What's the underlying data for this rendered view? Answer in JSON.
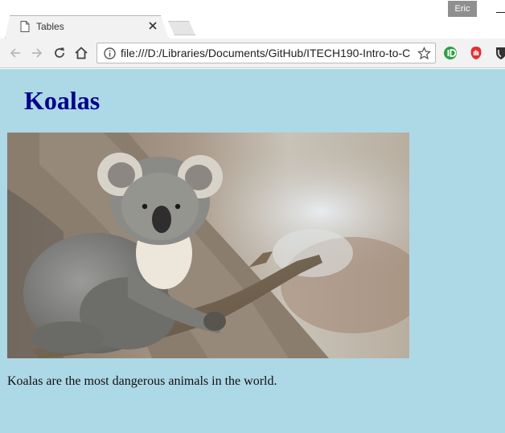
{
  "browser": {
    "profile_name": "Eric",
    "tab": {
      "title": "Tables"
    },
    "address_bar": {
      "url": "file:///D:/Libraries/Documents/GitHub/ITECH190-Intro-to-C"
    }
  },
  "page": {
    "heading": "Koalas",
    "image_alt": "Koala sitting on a tree branch",
    "paragraph": "Koalas are the most dangerous animals in the world.",
    "background_color": "#add8e6",
    "heading_color": "#00008b"
  },
  "icons": {
    "tab": "document-icon",
    "close": "close-icon",
    "back": "back-arrow-icon",
    "forward": "forward-arrow-icon",
    "reload": "reload-icon",
    "home": "home-icon",
    "info": "info-icon",
    "bookmark": "star-icon",
    "extension_1": "green-extension-icon",
    "extension_2": "adblock-icon",
    "extension_3": "shield-extension-icon"
  }
}
